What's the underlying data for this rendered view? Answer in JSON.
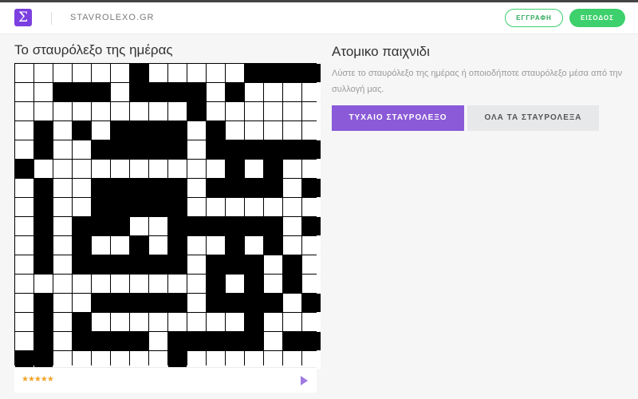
{
  "header": {
    "logo_glyph": "Σ",
    "site_name": "STAVROLEXO.GR",
    "register_label": "ΕΓΓΡΑΦΗ",
    "login_label": "ΕΙΣΟΔΟΣ"
  },
  "crossword": {
    "title": "Το σταυρόλεξο της ημέρας",
    "rows": [
      "..... #.....####.",
      "..###.####.#.....",
      ".........#......",
      ".#.#.####.#.....",
      ".#..#####.#######",
      "#..........#.#.",
      ".#..#####.####.#.",
      ".#..#####........",
      ".#.###..######.#.",
      ".#.#..#.#..#.#.",
      ".#.######.###.#.",
      "..........#.#.#.",
      ".#..#####.####.#",
      ".#.#........#...",
      ".#.####.#####.##",
      "##......#......."
    ],
    "rating_stars": "★★★★★"
  },
  "solo": {
    "title": "Ατομικο παιχνιδι",
    "description": "Λύστε το σταυρόλεξο της ημέρας ή οποιοδήποτε σταυρόλεξο μέσα από την συλλογή μας.",
    "random_button": "ΤΥΧΑΙΟ ΣΤΑΥΡΟΛΕΞΟ",
    "all_button": "ΟΛΑ ΤΑ ΣΤΑΥΡΟΛΕΞΑ"
  },
  "icons": {
    "play": "play-icon",
    "logo": "sigma-logo-icon"
  },
  "colors": {
    "brand_purple": "#8a5ad8",
    "accent_green": "#3dd06c",
    "star": "#f0a52a"
  }
}
